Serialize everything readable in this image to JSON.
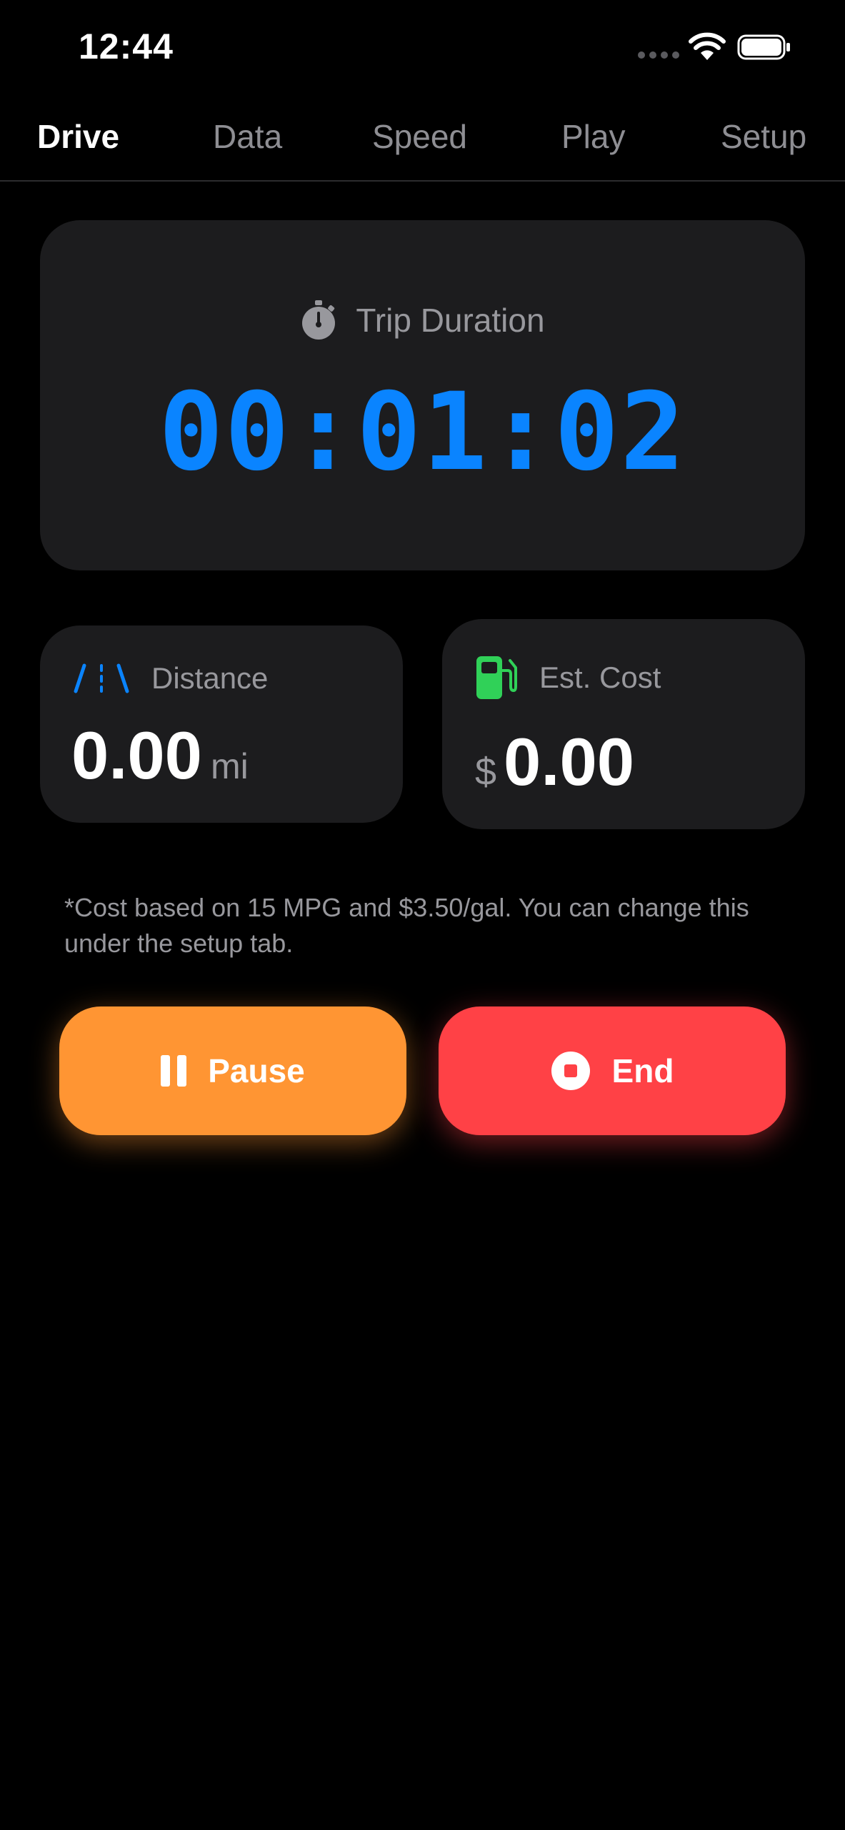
{
  "status_bar": {
    "time": "12:44"
  },
  "tabs": [
    {
      "label": "Drive",
      "active": true
    },
    {
      "label": "Data",
      "active": false
    },
    {
      "label": "Speed",
      "active": false
    },
    {
      "label": "Play",
      "active": false
    },
    {
      "label": "Setup",
      "active": false
    }
  ],
  "trip": {
    "label": "Trip Duration",
    "icon": "stopwatch-icon",
    "duration": "00:01:02",
    "color": "#0a84ff"
  },
  "distance": {
    "label": "Distance",
    "icon": "road-icon",
    "value": "0.00",
    "unit": "mi"
  },
  "cost": {
    "label": "Est. Cost",
    "icon": "fuel-icon",
    "currency": "$",
    "value": "0.00"
  },
  "note": "*Cost based on 15 MPG and $3.50/gal. You can change this under the setup tab.",
  "buttons": {
    "pause": {
      "label": "Pause",
      "icon": "pause-icon",
      "color": "#ff9533"
    },
    "end": {
      "label": "End",
      "icon": "stop-icon",
      "color": "#ff4146"
    }
  },
  "colors": {
    "background": "#000000",
    "card": "#1c1c1e",
    "secondary_text": "#98989d",
    "fuel_green": "#30d158"
  }
}
